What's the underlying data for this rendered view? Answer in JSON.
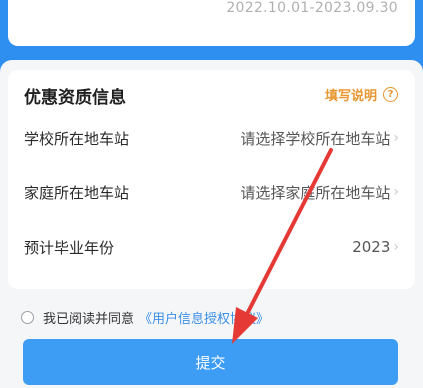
{
  "validity": {
    "date_range": "2022.10.01-2023.09.30"
  },
  "discount_card": {
    "title": "优惠资质信息",
    "help_label": "填写说明",
    "help_icon": "question-circle-icon",
    "rows": [
      {
        "label": "学校所在地车站",
        "value": "请选择学校所在地车站"
      },
      {
        "label": "家庭所在地车站",
        "value": "请选择家庭所在地车站"
      },
      {
        "label": "预计毕业年份",
        "value": "2023"
      }
    ]
  },
  "agreement": {
    "prefix": "我已阅读并同意",
    "link": "《用户信息授权协议》"
  },
  "submit_label": "提交",
  "colors": {
    "brand_blue": "#2f8ff0",
    "button_blue": "#3d9cf3",
    "help_orange": "#e8962f",
    "annotation_red": "#e53935"
  }
}
